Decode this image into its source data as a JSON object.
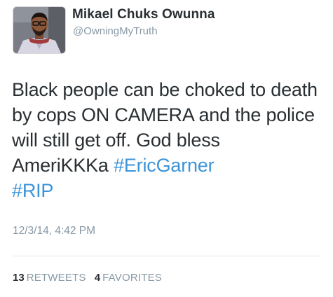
{
  "author": {
    "display_name": "Mikael Chuks Owunna",
    "handle": "@OwningMyTruth"
  },
  "tweet": {
    "text_before": "Black people can be choked to death by cops ON CAMERA and the police will still get off. God bless AmeriKKKa ",
    "hashtags": [
      "#EricGarner",
      "#RIP"
    ],
    "timestamp": "12/3/14, 4:42 PM"
  },
  "stats": {
    "retweets_count": "13",
    "retweets_label": "RETWEETS",
    "favorites_count": "4",
    "favorites_label": "FAVORITES"
  },
  "colors": {
    "text": "#292f33",
    "muted": "#8899a6",
    "link": "#3b94d9",
    "divider": "#e1e8ed"
  },
  "icons": {
    "avatar": "profile-photo"
  }
}
